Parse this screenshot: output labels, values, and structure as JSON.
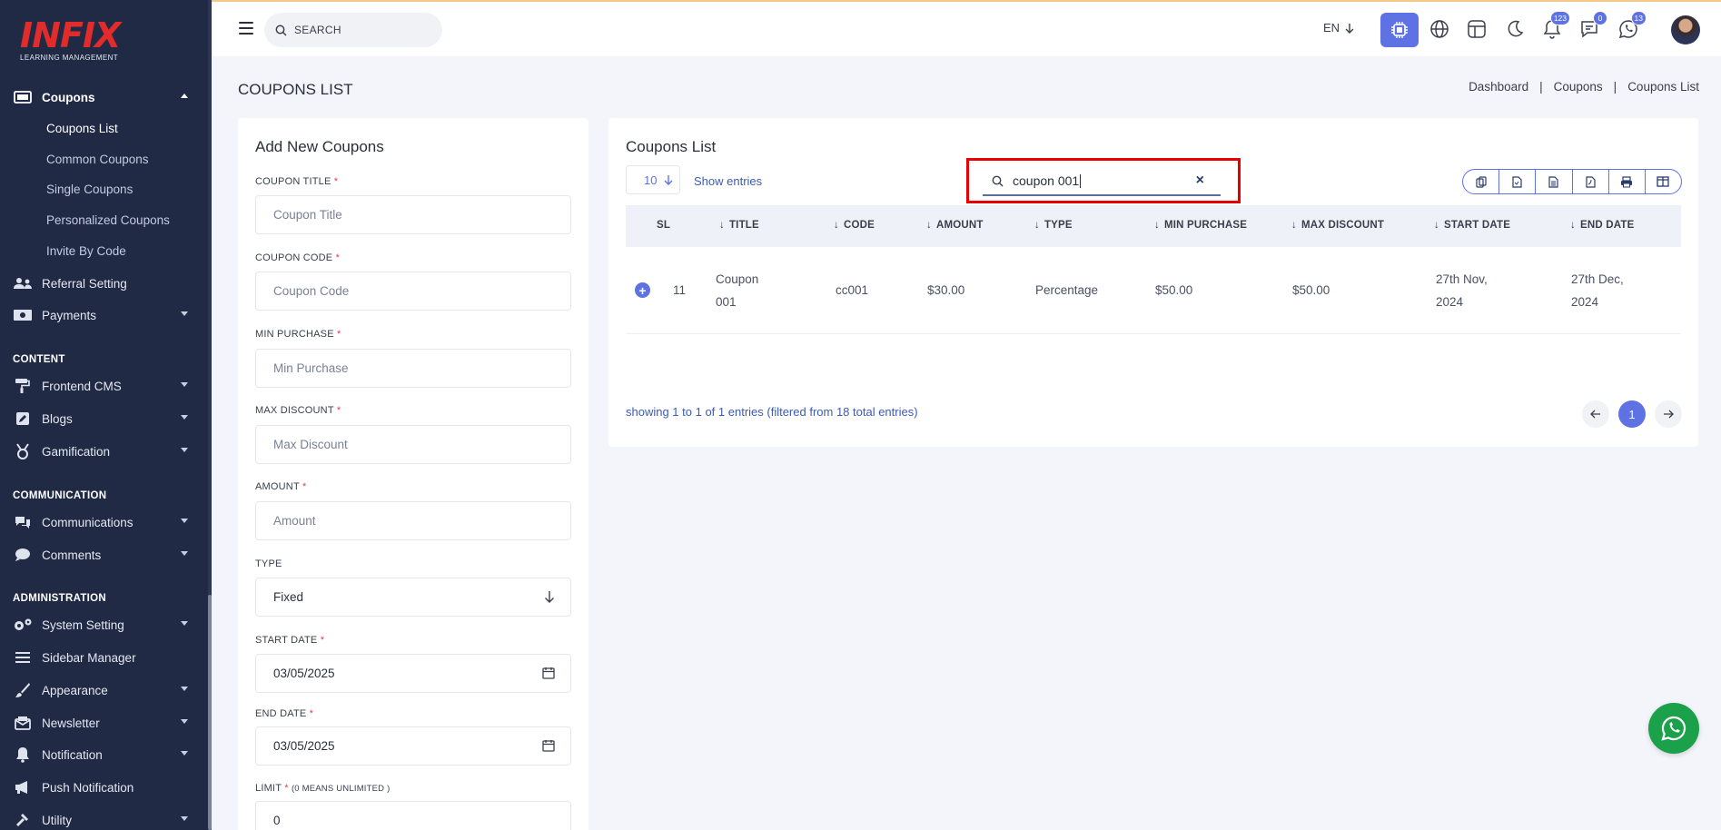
{
  "brand": {
    "logo_text": "INFIX",
    "logo_subtitle": "LEARNING MANAGEMENT",
    "accent": "#5e72e4",
    "logo_color": "#e22b2b"
  },
  "sidebar": {
    "coupons": "Coupons",
    "coupon_subitems": [
      "Coupons List",
      "Common Coupons",
      "Single Coupons",
      "Personalized Coupons",
      "Invite By Code"
    ],
    "referral": "Referral Setting",
    "payments": "Payments",
    "section_content": "CONTENT",
    "frontend_cms": "Frontend CMS",
    "blogs": "Blogs",
    "gamification": "Gamification",
    "section_communication": "COMMUNICATION",
    "communications": "Communications",
    "comments": "Comments",
    "section_administration": "ADMINISTRATION",
    "system_setting": "System Setting",
    "sidebar_manager": "Sidebar Manager",
    "appearance": "Appearance",
    "newsletter": "Newsletter",
    "notification": "Notification",
    "push_notification": "Push Notification",
    "utility": "Utility"
  },
  "header": {
    "search_placeholder": "SEARCH",
    "language": "EN",
    "badges": {
      "notifications": "123",
      "messages": "0",
      "whatsapp": "13"
    }
  },
  "page": {
    "title": "COUPONS LIST",
    "breadcrumb": [
      "Dashboard",
      "Coupons",
      "Coupons List"
    ]
  },
  "form": {
    "heading": "Add New Coupons",
    "coupon_title_label": "COUPON TITLE",
    "coupon_title_placeholder": "Coupon Title",
    "coupon_code_label": "COUPON CODE",
    "coupon_code_placeholder": "Coupon Code",
    "min_purchase_label": "MIN PURCHASE",
    "min_purchase_placeholder": "Min Purchase",
    "max_discount_label": "MAX DISCOUNT",
    "max_discount_placeholder": "Max Discount",
    "amount_label": "AMOUNT",
    "amount_placeholder": "Amount",
    "type_label": "TYPE",
    "type_value": "Fixed",
    "start_date_label": "START DATE",
    "start_date_value": "03/05/2025",
    "end_date_label": "END DATE",
    "end_date_value": "03/05/2025",
    "limit_label": "LIMIT",
    "limit_hint": "(0 MEANS UNLIMITED )",
    "limit_value": "0",
    "required_mark": "*"
  },
  "list": {
    "heading": "Coupons List",
    "page_length": "10",
    "show_entries": "Show entries",
    "search_value": "coupon 001",
    "clear": "×",
    "columns": [
      "SL",
      "TITLE",
      "CODE",
      "AMOUNT",
      "TYPE",
      "MIN PURCHASE",
      "MAX DISCOUNT",
      "START DATE",
      "END DATE"
    ],
    "rows": [
      {
        "sl": "11",
        "title": "Coupon 001",
        "code": "cc001",
        "amount": "$30.00",
        "type": "Percentage",
        "min_purchase": "$50.00",
        "max_discount": "$50.00",
        "start_date": "27th Nov, 2024",
        "end_date": "27th Dec, 2024"
      }
    ],
    "info": "showing 1 to 1 of 1 entries (filtered from 18 total entries)",
    "current_page": "1",
    "export_buttons": [
      "copy-icon",
      "csv-icon",
      "excel-icon",
      "pdf-icon",
      "print-icon",
      "columns-icon"
    ]
  }
}
